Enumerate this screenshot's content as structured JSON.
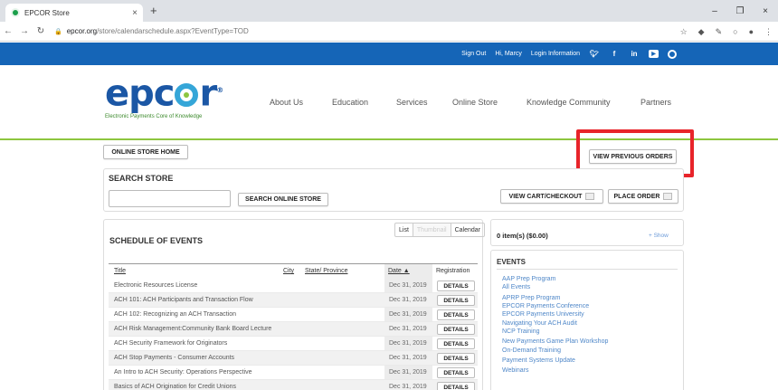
{
  "browser": {
    "tab_title": "EPCOR Store",
    "tab_close": "×",
    "new_tab": "+",
    "url_host": "epcor.org",
    "url_path": "/store/calendarschedule.aspx?EventType=TOD",
    "win_min": "–",
    "win_max": "❐",
    "win_close": "×"
  },
  "topbar": {
    "sign_out": "Sign Out",
    "greeting": "Hi, Marcy",
    "login_info": "Login Information"
  },
  "brand": {
    "logo_left": "epc",
    "logo_right": "r",
    "tagline": "Electronic Payments Core of Knowledge"
  },
  "nav": {
    "about": "About Us",
    "education": "Education",
    "services": "Services",
    "online_store": "Online Store",
    "community": "Knowledge Community",
    "partners": "Partners"
  },
  "store": {
    "home_button": "ONLINE STORE HOME",
    "view_previous_orders": "VIEW PREVIOUS ORDERS",
    "search_heading": "SEARCH STORE",
    "search_button": "SEARCH ONLINE STORE",
    "search_value": "",
    "cart_button": "VIEW CART/CHECKOUT",
    "place_order_button": "PLACE ORDER"
  },
  "schedule": {
    "heading": "SCHEDULE OF EVENTS",
    "views": [
      "List",
      "Thumbnail",
      "Calendar"
    ],
    "columns": {
      "title": "Title",
      "city": "City",
      "state": "State/ Province",
      "date": "Date ▲",
      "registration": "Registration"
    },
    "details_label": "DETAILS",
    "rows": [
      {
        "title": "Electronic Resources License",
        "date": "Dec 31, 2019"
      },
      {
        "title": "ACH 101: ACH Participants and Transaction Flow",
        "date": "Dec 31, 2019"
      },
      {
        "title": "ACH 102: Recognizing an ACH Transaction",
        "date": "Dec 31, 2019"
      },
      {
        "title": "ACH Risk Management:Community Bank Board Lecture",
        "date": "Dec 31, 2019"
      },
      {
        "title": "ACH Security Framework for Originators",
        "date": "Dec 31, 2019"
      },
      {
        "title": "ACH Stop Payments - Consumer Accounts",
        "date": "Dec 31, 2019"
      },
      {
        "title": "An Intro to ACH Security: Operations Perspective",
        "date": "Dec 31, 2019"
      },
      {
        "title": "Basics of ACH Origination for Credit Unions",
        "date": "Dec 31, 2019"
      }
    ]
  },
  "cart": {
    "summary": "0 item(s) ($0.00)",
    "show": "+ Show"
  },
  "events": {
    "heading": "EVENTS",
    "links": [
      "AAP Prep Program",
      "All Events",
      "APRP Prep Program",
      "EPCOR Payments Conference",
      "EPCOR Payments University",
      "Navigating Your ACH Audit",
      "NCP Training",
      "New Payments Game Plan Workshop",
      "On-Demand Training",
      "Payment Systems Update",
      "Webinars"
    ]
  },
  "colors": {
    "topbar": "#1565b7",
    "brand_blue": "#1b57a5",
    "accent_green": "#8dc63f",
    "link": "#4f87c8",
    "highlight": "#e8242a"
  }
}
